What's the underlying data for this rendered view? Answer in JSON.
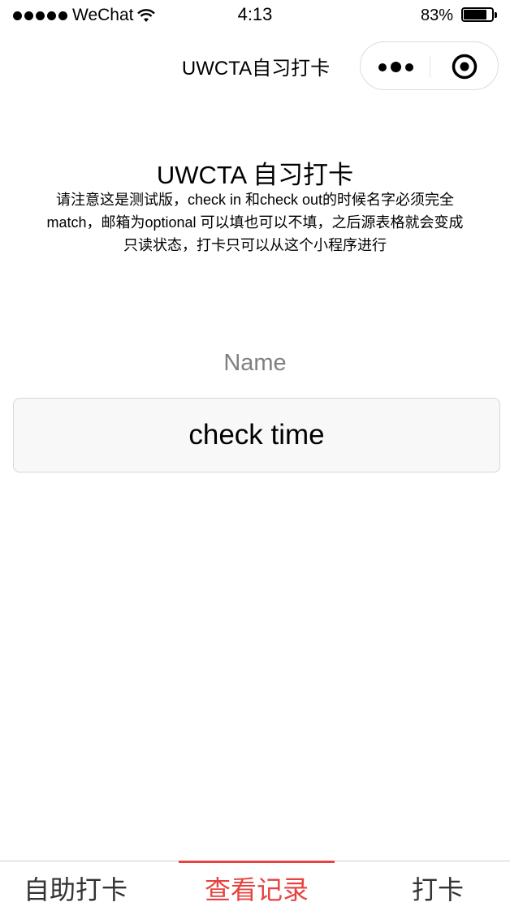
{
  "status_bar": {
    "carrier": "WeChat",
    "time": "4:13",
    "battery": "83%",
    "battery_level": 0.83
  },
  "nav": {
    "title": "UWCTA自习打卡"
  },
  "content": {
    "heading": "UWCTA 自习打卡",
    "notice": "请注意这是测试版，check in 和check out的时候名字必须完全match，邮箱为optional 可以填也可以不填，之后源表格就会变成只读状态，打卡只可以从这个小程序进行",
    "name_placeholder": "Name",
    "check_time_label": "check time"
  },
  "tabbar": {
    "tabs": [
      {
        "label": "自助打卡",
        "active": false
      },
      {
        "label": "查看记录",
        "active": true
      },
      {
        "label": "打卡",
        "active": false
      }
    ],
    "active_color": "#e64340"
  }
}
